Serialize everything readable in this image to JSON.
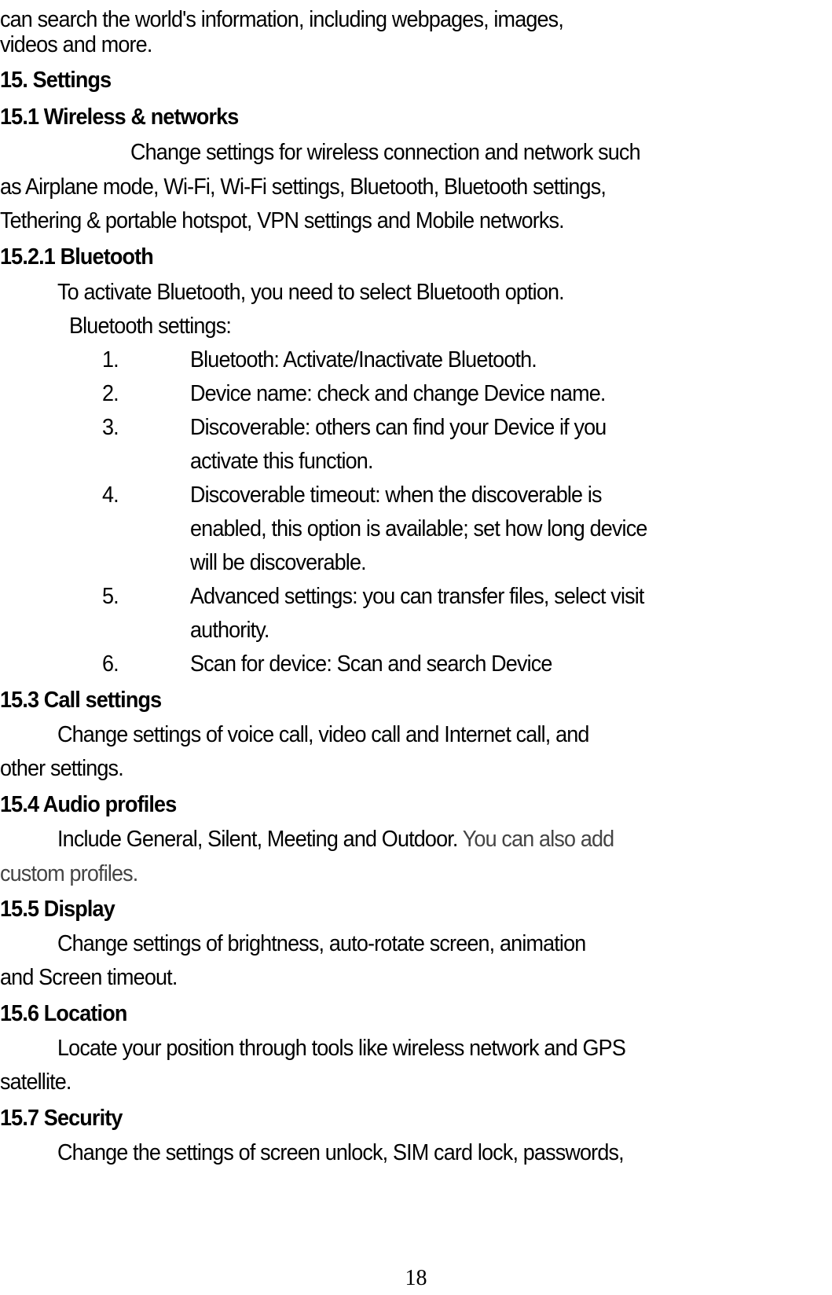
{
  "page": {
    "intro": [
      "can search the world's information, including webpages, images,",
      "videos and more."
    ],
    "section_15": {
      "heading": "15. Settings"
    },
    "section_15_1": {
      "heading": "15.1 Wireless & networks",
      "body": [
        "Change settings for wireless connection and network such",
        "as Airplane mode, Wi-Fi, Wi-Fi settings, Bluetooth, Bluetooth settings,",
        "Tethering & portable hotspot, VPN settings and Mobile networks."
      ]
    },
    "section_15_2_1": {
      "heading": "15.2.1 Bluetooth",
      "body": "To activate Bluetooth, you need to select Bluetooth option.",
      "subheading": "Bluetooth settings:",
      "items": [
        {
          "num": "1.",
          "lines": [
            "Bluetooth: Activate/Inactivate Bluetooth."
          ]
        },
        {
          "num": "2.",
          "lines": [
            "Device name: check and change Device name."
          ]
        },
        {
          "num": "3.",
          "lines": [
            "Discoverable: others can find your Device if you",
            "activate this function."
          ]
        },
        {
          "num": "4.",
          "lines": [
            "Discoverable timeout: when the discoverable is",
            "enabled, this option is available; set how long device",
            "will be discoverable."
          ]
        },
        {
          "num": "5.",
          "lines": [
            "Advanced settings: you can transfer files, select visit",
            "authority."
          ]
        },
        {
          "num": "6.",
          "lines": [
            "Scan for device: Scan and search Device"
          ]
        }
      ]
    },
    "section_15_3": {
      "heading": "15.3 Call settings",
      "body": [
        "Change settings of voice call, video call and Internet call, and",
        "other settings."
      ]
    },
    "section_15_4": {
      "heading": "15.4 Audio profiles",
      "body_main": "Include General, Silent, Meeting and Outdoor.",
      "body_gray_1": "You can also add",
      "body_gray_2": "custom profiles."
    },
    "section_15_5": {
      "heading": "15.5 Display",
      "body": [
        "Change settings of brightness, auto-rotate screen, animation",
        "and Screen timeout."
      ]
    },
    "section_15_6": {
      "heading": "15.6 Location",
      "body": [
        "Locate your position through tools like wireless network and GPS",
        "satellite."
      ]
    },
    "section_15_7": {
      "heading": "15.7 Security",
      "body": [
        "Change the settings of screen unlock, SIM card lock, passwords,"
      ]
    },
    "page_number": "18"
  }
}
